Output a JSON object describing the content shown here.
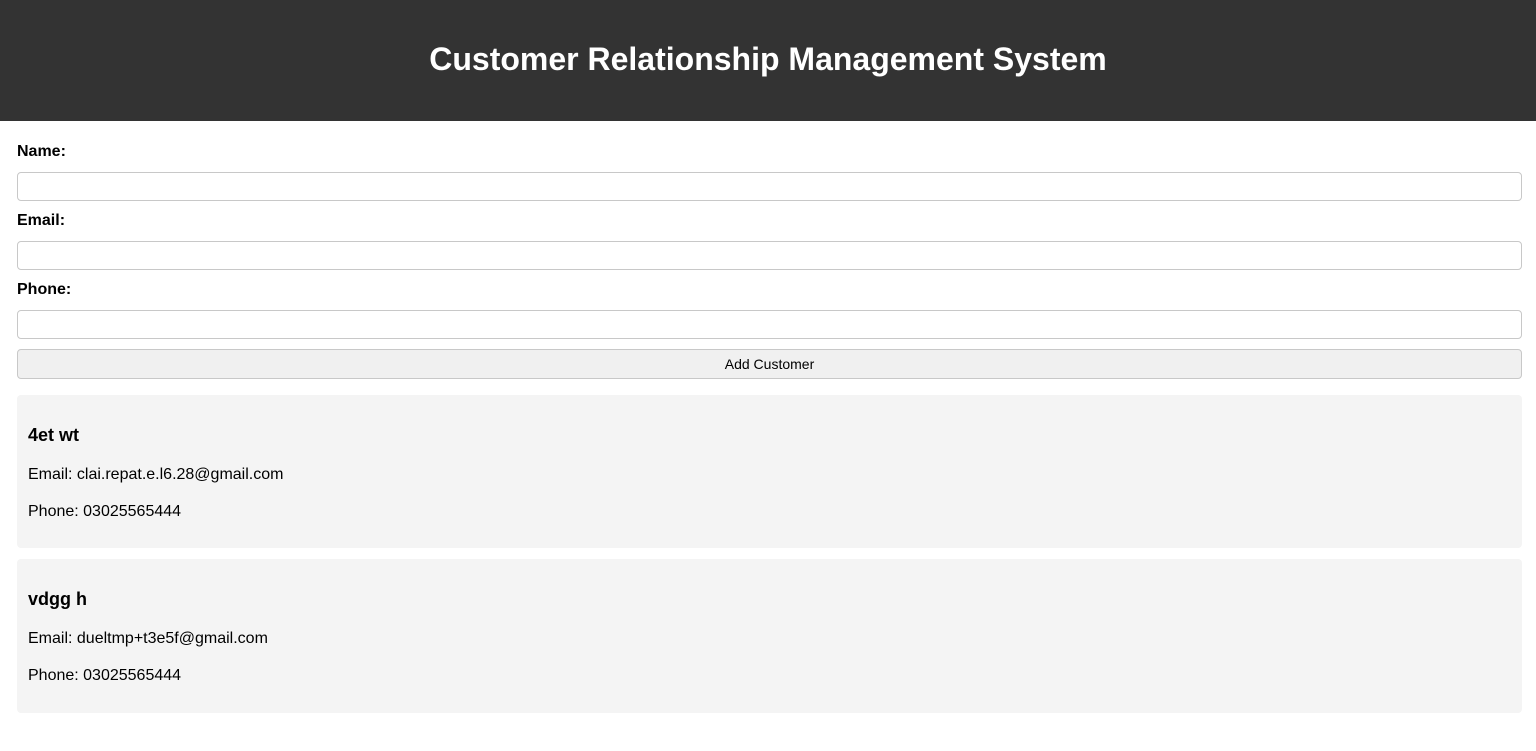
{
  "header": {
    "title": "Customer Relationship Management System"
  },
  "form": {
    "name_label": "Name:",
    "name_value": "",
    "email_label": "Email:",
    "email_value": "",
    "phone_label": "Phone:",
    "phone_value": "",
    "submit_label": "Add Customer"
  },
  "customers": [
    {
      "name": "4et wt",
      "email": "Email: clai.repat.e.l6.28@gmail.com",
      "phone": "Phone: 03025565444"
    },
    {
      "name": "vdgg h",
      "email": "Email: dueltmp+t3e5f@gmail.com",
      "phone": "Phone: 03025565444"
    }
  ],
  "colors": {
    "header_bg": "#333333",
    "card_bg": "#f4f4f4",
    "button_bg": "#f0f0f0"
  }
}
